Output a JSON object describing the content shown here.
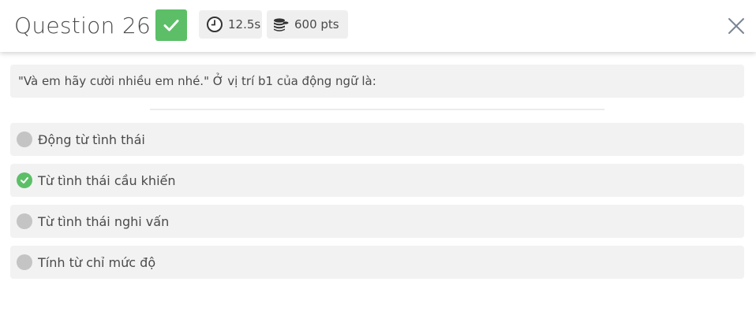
{
  "header": {
    "title": "Question 26",
    "time": "12.5s",
    "points": "600 pts",
    "colors": {
      "correct": "#5cbf67",
      "close": "#7a8595"
    }
  },
  "question": {
    "text": "\"Và em hãy cười nhiều em nhé.\" Ở vị trí b1 của động ngữ là:"
  },
  "options": [
    {
      "label": "Động từ tình thái",
      "correct": false
    },
    {
      "label": "Từ tình thái cầu khiến",
      "correct": true
    },
    {
      "label": "Từ tình thái nghi vấn",
      "correct": false
    },
    {
      "label": "Tính từ chỉ mức độ",
      "correct": false
    }
  ]
}
